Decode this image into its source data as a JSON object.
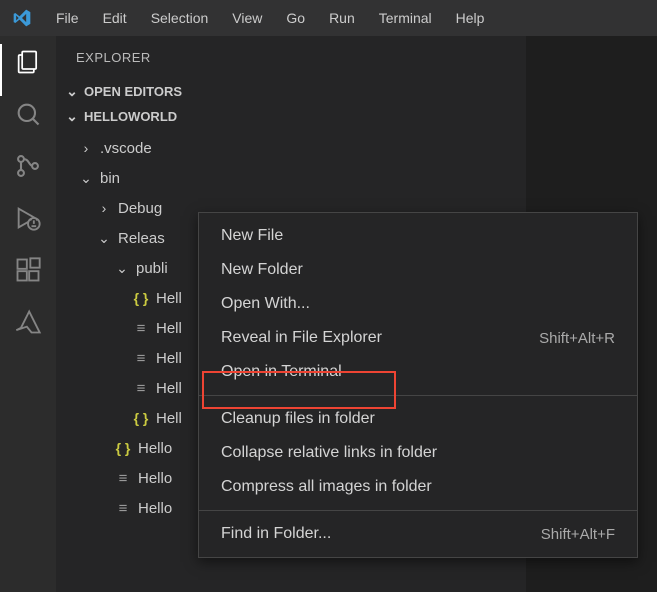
{
  "menubar": [
    "File",
    "Edit",
    "Selection",
    "View",
    "Go",
    "Run",
    "Terminal",
    "Help"
  ],
  "sidebar": {
    "title": "EXPLORER",
    "open_editors": "OPEN EDITORS",
    "project": "HELLOWORLD"
  },
  "tree": {
    "vscode": ".vscode",
    "bin": "bin",
    "debug": "Debug",
    "release": "Releas",
    "publish": "publi",
    "hell1": "Hell",
    "hell2": "Hell",
    "hell3": "Hell",
    "hell4": "Hell",
    "hell5": "Hell",
    "hello1": "Hello",
    "hello2": "Hello",
    "hello3": "Hello"
  },
  "context": {
    "new_file": "New File",
    "new_folder": "New Folder",
    "open_with": "Open With...",
    "reveal": "Reveal in File Explorer",
    "reveal_sc": "Shift+Alt+R",
    "open_terminal": "Open in Terminal",
    "cleanup": "Cleanup files in folder",
    "collapse": "Collapse relative links in folder",
    "compress": "Compress all images in folder",
    "find": "Find in Folder...",
    "find_sc": "Shift+Alt+F"
  }
}
